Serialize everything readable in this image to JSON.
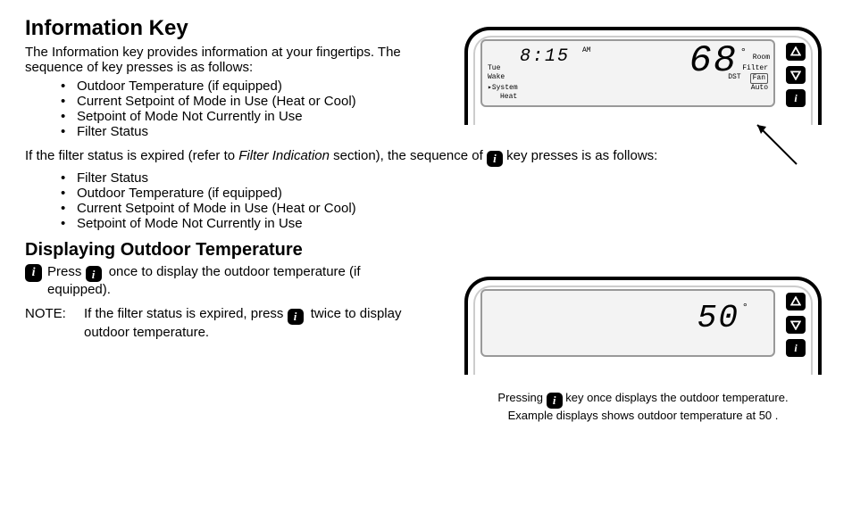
{
  "section": {
    "title": "Information Key",
    "intro": "The Information key provides information at your fingertips. The sequence of key presses is as follows:",
    "bullets_primary": [
      "Outdoor Temperature (if equipped)",
      "Current Setpoint of Mode in Use (Heat or Cool)",
      "Setpoint of Mode Not Currently in Use",
      "Filter Status"
    ],
    "para2_lead": "If the filter status is expired (refer to ",
    "para2_italic": "Filter Indication",
    "para2_mid": " section), the sequence of ",
    "para2_tail": " key presses is as follows:",
    "bullets_secondary": [
      "Filter Status",
      "Outdoor Temperature (if equipped)",
      "Current Setpoint of Mode in Use (Heat or Cool)",
      "Setpoint of Mode Not Currently in Use"
    ]
  },
  "outdoor": {
    "title": "Displaying Outdoor Temperature",
    "press_lead": "Press ",
    "press_tail": " once to display the outdoor temperature (if equipped).",
    "note_label": "NOTE:",
    "note_lead": "If the filter status is expired, press ",
    "note_tail": " twice to display outdoor temperature."
  },
  "display1": {
    "time": "8:15",
    "ampm": "AM",
    "temp": "68",
    "deg": "°",
    "room": "Room",
    "day": "Tue",
    "wake": "Wake",
    "system": "System",
    "heat": "Heat",
    "filter": "Filter",
    "dst": "DST",
    "fan": "Fan",
    "auto": "Auto"
  },
  "display2": {
    "temp": "50",
    "deg": "°"
  },
  "caption": {
    "line1_lead": "Pressing ",
    "line1_tail": " key once displays the outdoor temperature.",
    "line2": "Example displays shows outdoor temperature at 50 ."
  },
  "icons": {
    "info_glyph": "i"
  }
}
